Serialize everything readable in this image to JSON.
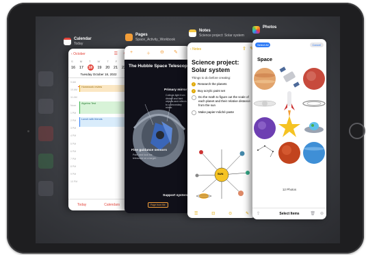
{
  "calendar": {
    "app_name": "Calendar",
    "subtitle": "Today",
    "back_label": "October",
    "weekdays": [
      "S",
      "M",
      "T",
      "W",
      "T",
      "F",
      "S"
    ],
    "days": [
      "16",
      "17",
      "18",
      "19",
      "20",
      "21",
      "22"
    ],
    "date_line": "Tuesday October 18, 2022",
    "events": [
      "Homework review",
      "Algebra Test",
      "Lunch with friends"
    ],
    "times": [
      "9 AM",
      "10 AM",
      "11 AM",
      "Noon",
      "1 PM",
      "2 PM",
      "3 PM",
      "4 PM",
      "5 PM",
      "6 PM",
      "7 PM",
      "8 PM",
      "9 PM",
      "10 PM"
    ],
    "tab_today": "Today",
    "tab_calendars": "Calendars"
  },
  "pages": {
    "app_name": "Pages",
    "subtitle": "Space_Activity_Workbook",
    "heading": "The Hubble Space Telescope",
    "primary_title": "Primary mirror",
    "primary_text": "Collects light from distant and faint objects and reflects it to a secondary mirror.",
    "fine_title": "Fine guidance sensors",
    "fine_text": "Point and lock the telescope on a target.",
    "support_title": "Support systems",
    "button_label": "Page from file"
  },
  "notes": {
    "app_name": "Notes",
    "subtitle": "Science project: Solar system",
    "back_label": "Notes",
    "title": "Science project: Solar system",
    "intro": "Things to do before creating:",
    "checklist": [
      {
        "text": "Research the planets",
        "checked": true
      },
      {
        "text": "Buy acrylic paint set",
        "checked": true
      },
      {
        "text": "Do the math to figure out the scale of each planet and their relative distance from the sun",
        "checked": false
      },
      {
        "text": "Make papier-mâché paste",
        "checked": false
      }
    ],
    "sun_label": "SUN"
  },
  "photos": {
    "app_name": "Photos",
    "select_all": "Select All",
    "cancel": "Cancel",
    "album": "Space",
    "count": "12 Photos",
    "select_items": "Select Items"
  },
  "colors": {
    "accent_red": "#e3443a",
    "accent_yellow": "#e0a800",
    "accent_blue": "#2f7cf6",
    "pages_orange": "#f29d38"
  }
}
